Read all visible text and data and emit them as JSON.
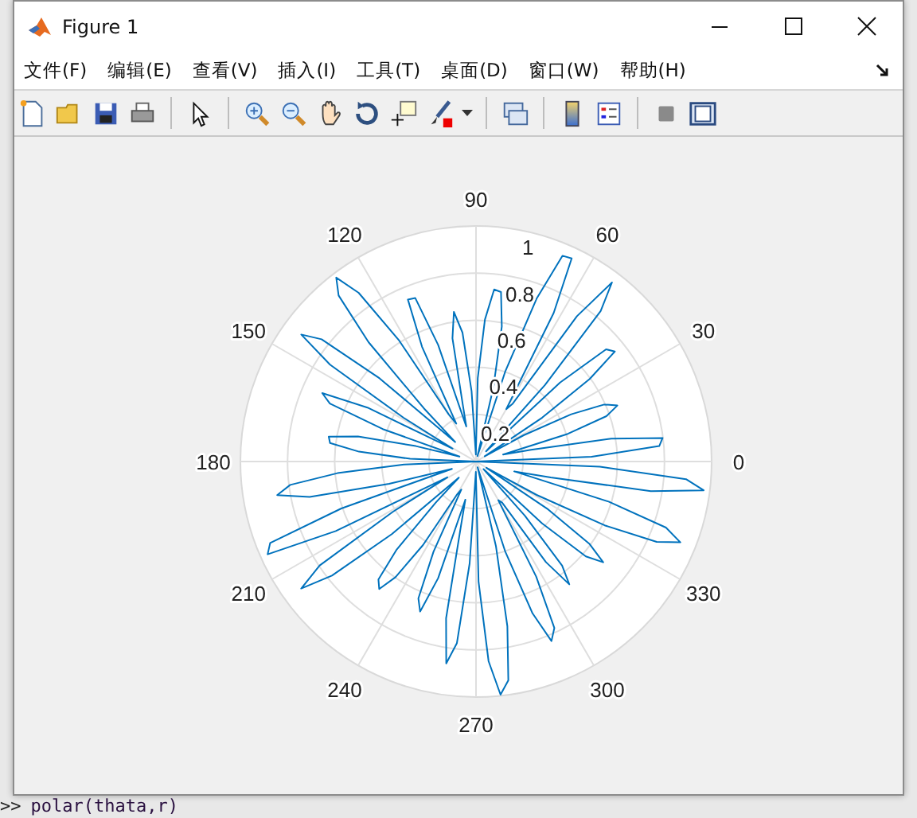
{
  "window": {
    "title": "Figure 1"
  },
  "menu": [
    "文件(F)",
    "编辑(E)",
    "查看(V)",
    "插入(I)",
    "工具(T)",
    "桌面(D)",
    "窗口(W)",
    "帮助(H)"
  ],
  "plot": {
    "angle_labels": [
      "0",
      "30",
      "60",
      "90",
      "120",
      "150",
      "180",
      "210",
      "240",
      "270",
      "300",
      "330"
    ],
    "radius_labels": [
      "1",
      "0.8",
      "0.6",
      "0.4",
      "0.2"
    ]
  },
  "command_line": {
    "prompt": ">>",
    "command": "polar(thata,r)"
  }
}
